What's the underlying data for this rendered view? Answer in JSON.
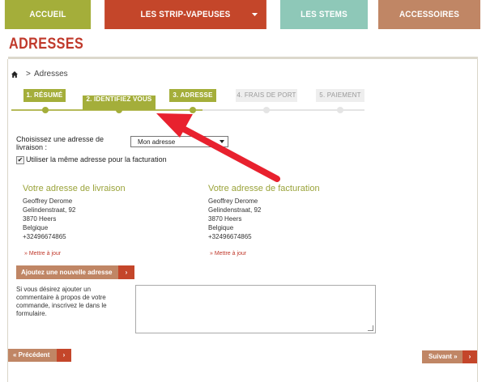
{
  "nav": {
    "items": [
      {
        "label": "ACCUEIL"
      },
      {
        "label": "LES STRIP-VAPEUSES"
      },
      {
        "label": "LES STEMS"
      },
      {
        "label": "ACCESSOIRES"
      }
    ]
  },
  "page": {
    "title": "ADRESSES"
  },
  "breadcrumb": {
    "separator": ">",
    "current": "Adresses"
  },
  "steps": [
    {
      "label": "1. RÉSUMÉ",
      "state": "done"
    },
    {
      "label": "2. IDENTIFIEZ VOUS",
      "state": "done"
    },
    {
      "label": "3. ADRESSE",
      "state": "current"
    },
    {
      "label": "4. FRAIS DE PORT",
      "state": "todo"
    },
    {
      "label": "5. PAIEMENT",
      "state": "todo"
    }
  ],
  "form": {
    "choose_label_1": "Choisissez une adresse de",
    "choose_label_2": "livraison :",
    "selected_address": "Mon adresse",
    "same_address_label": "Utiliser la même adresse pour la facturation",
    "same_address_checked": "✔"
  },
  "delivery": {
    "heading": "Votre adresse de livraison",
    "name": "Geoffrey Derome",
    "street": "Gelindenstraat, 92",
    "city": "3870 Heers",
    "country": "Belgique",
    "phone": "+32496674865",
    "update_link": "» Mettre à jour"
  },
  "billing": {
    "heading": "Votre adresse de facturation",
    "name": "Geoffrey Derome",
    "street": "Gelindenstraat, 92",
    "city": "3870 Heers",
    "country": "Belgique",
    "phone": "+32496674865",
    "update_link": "» Mettre à jour"
  },
  "buttons": {
    "add_address": "Ajoutez une nouvelle adresse",
    "arrow": "›",
    "previous": "« Précédent",
    "next": "Suivant »"
  },
  "comment": {
    "line1": "Si vous désirez ajouter un",
    "line2": "commentaire à propos de votre",
    "line3": "commande, inscrivez le dans le",
    "line4": "formulaire.",
    "value": ""
  },
  "colors": {
    "olive": "#a4ae3a",
    "rust": "#c4462a",
    "teal": "#8ec8b8",
    "tan": "#c08665",
    "annotation_arrow": "#e8212e"
  },
  "annotation": {
    "icon": "red-arrow-icon"
  }
}
